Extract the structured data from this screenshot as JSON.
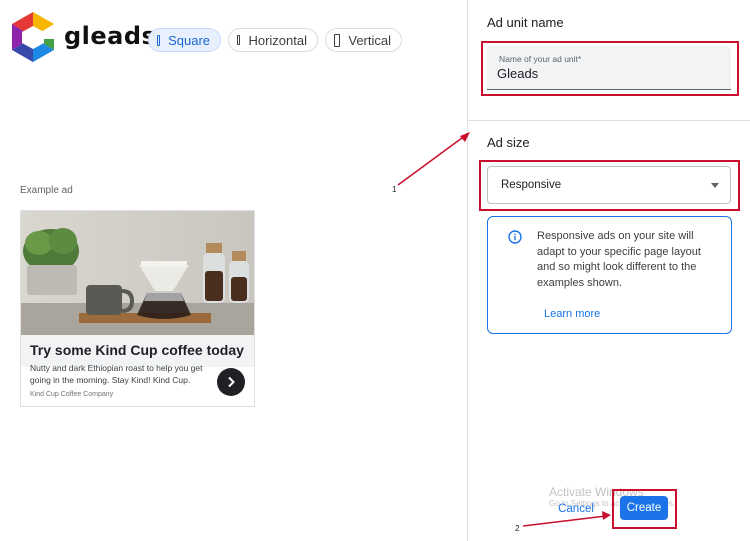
{
  "brand": {
    "name": "gleads"
  },
  "formats": [
    {
      "label": "Square",
      "active": true
    },
    {
      "label": "Horizontal",
      "active": false
    },
    {
      "label": "Vertical",
      "active": false
    }
  ],
  "example_ad": {
    "label": "Example ad",
    "title": "Try some Kind Cup coffee today",
    "body": "Nutty and dark Ethiopian roast to help you get going in the morning. Stay Kind! Kind Cup.",
    "company": "Kind Cup Coffee Company"
  },
  "ad_unit": {
    "section_title": "Ad unit name",
    "field_label": "Name of your ad unit*",
    "field_value": "Gleads"
  },
  "ad_size": {
    "section_title": "Ad size",
    "selected": "Responsive",
    "info_text": "Responsive ads on your site will adapt to your specific page layout and so might look different to the examples shown.",
    "learn_more": "Learn more"
  },
  "actions": {
    "cancel": "Cancel",
    "create": "Create"
  },
  "watermark": {
    "line1": "Activate Windows",
    "line2": "Go to Settings to activate Windows."
  },
  "annotations": {
    "step1": "1",
    "step2": "2"
  },
  "colors": {
    "accent": "#1a73e8",
    "annotation_red": "#c8102e",
    "chip_active_bg": "#e8f0fe"
  }
}
